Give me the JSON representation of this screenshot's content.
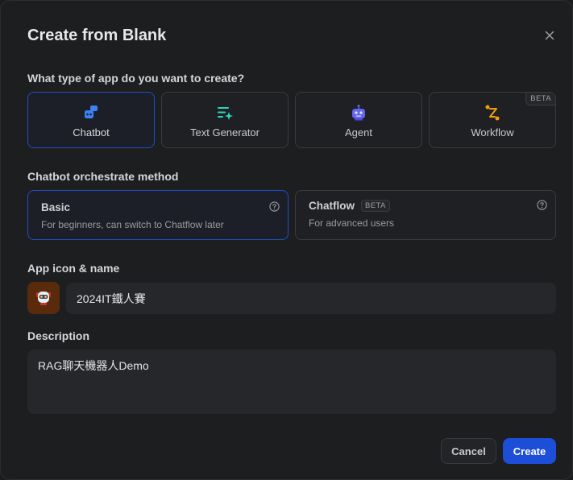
{
  "dialog": {
    "title": "Create from Blank",
    "close_icon": "close-icon"
  },
  "app_type": {
    "label": "What type of app do you want to create?",
    "options": [
      {
        "label": "Chatbot",
        "icon": "chatbot-icon",
        "color": "#3b82f6",
        "selected": true
      },
      {
        "label": "Text Generator",
        "icon": "text-generator-icon",
        "color": "#2dd4bf",
        "selected": false
      },
      {
        "label": "Agent",
        "icon": "agent-icon",
        "color": "#6366f1",
        "selected": false
      },
      {
        "label": "Workflow",
        "icon": "workflow-icon",
        "color": "#f59e0b",
        "selected": false,
        "badge": "BETA"
      }
    ]
  },
  "orchestrate": {
    "label": "Chatbot orchestrate method",
    "options": [
      {
        "title": "Basic",
        "desc": "For beginners, can switch to Chatflow later",
        "selected": true
      },
      {
        "title": "Chatflow",
        "badge": "BETA",
        "desc": "For advanced users",
        "selected": false
      }
    ]
  },
  "app_name": {
    "label": "App icon & name",
    "value": "2024IT鐵人賽",
    "icon": "robot-avatar-icon"
  },
  "description": {
    "label": "Description",
    "value": "RAG聊天機器人Demo"
  },
  "actions": {
    "cancel": "Cancel",
    "create": "Create"
  },
  "colors": {
    "accent": "#1d4ed8",
    "selected_border": "#1e4fc2",
    "background": "#1d1e20"
  }
}
